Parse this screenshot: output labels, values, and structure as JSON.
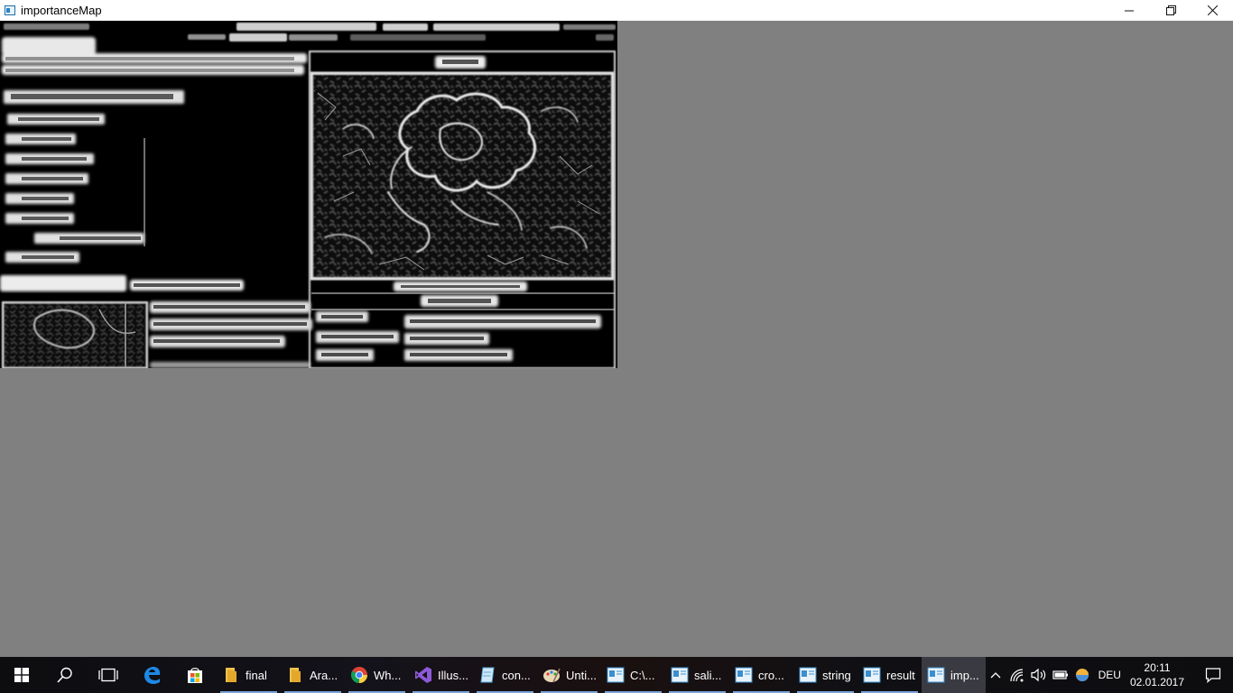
{
  "window": {
    "title": "importanceMap",
    "controls": {
      "minimize": "minimize-icon",
      "maximize": "restore-icon",
      "close": "close-icon"
    }
  },
  "image": {
    "description_icon": "importance-map-image",
    "background": "#000000",
    "stroke": "#e8e8e8"
  },
  "taskbar": {
    "apps": [
      {
        "label": "final",
        "icon": "folder-icon"
      },
      {
        "label": "Ara...",
        "icon": "folder-icon"
      },
      {
        "label": "Wh...",
        "icon": "chrome-icon"
      },
      {
        "label": "Illus...",
        "icon": "visual-studio-icon"
      },
      {
        "label": "con...",
        "icon": "notepad-icon"
      },
      {
        "label": "Unti...",
        "icon": "paint-icon"
      },
      {
        "label": "C:\\...",
        "icon": "window-icon"
      },
      {
        "label": "sali...",
        "icon": "window-icon"
      },
      {
        "label": "cro...",
        "icon": "window-icon"
      },
      {
        "label": "string",
        "icon": "window-icon"
      },
      {
        "label": "result",
        "icon": "window-icon"
      },
      {
        "label": "imp...",
        "icon": "window-icon"
      }
    ],
    "language": "DEU",
    "time": "20:11",
    "date": "02.01.2017"
  }
}
